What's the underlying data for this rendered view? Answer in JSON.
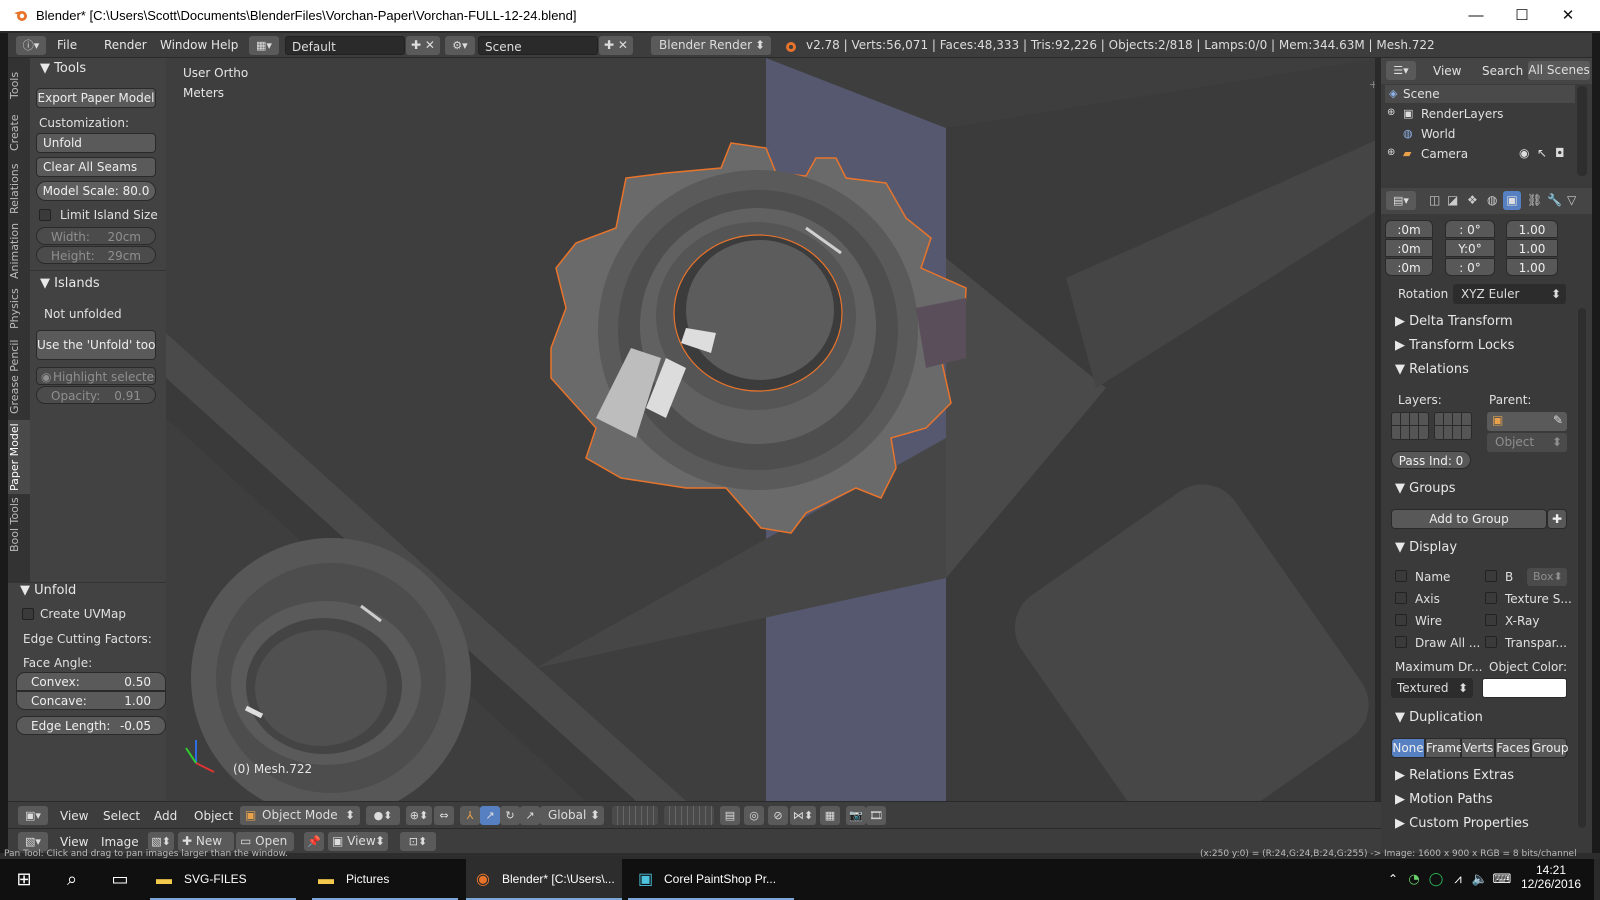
{
  "window": {
    "title": "Blender* [C:\\Users\\Scott\\Documents\\BlenderFiles\\Vorchan-Paper\\Vorchan-FULL-12-24.blend]",
    "minimize": "—",
    "maximize": "☐",
    "close": "✕"
  },
  "menubar": {
    "menus": [
      "File",
      "Render",
      "Window",
      "Help"
    ],
    "layout": "Default",
    "scene": "Scene",
    "engine": "Blender Render",
    "stats": "v2.78 | Verts:56,071 | Faces:48,333 | Tris:92,226 | Objects:2/818 | Lamps:0/0 | Mem:344.63M | Mesh.722"
  },
  "left_tabs": [
    "Tools",
    "Create",
    "Relations",
    "Animation",
    "Physics",
    "Grease Pencil",
    "Paper Model",
    "Bool Tools"
  ],
  "tools_panel": {
    "header": "Tools",
    "export_button": "Export Paper Model",
    "customization_label": "Customization:",
    "unfold_button": "Unfold",
    "clear_seams_button": "Clear All Seams",
    "model_scale": "Model Scale: 80.0",
    "limit_island_size": "Limit Island Size",
    "width_label": "Width:",
    "width_value": "20cm",
    "height_label": "Height:",
    "height_value": "29cm"
  },
  "islands_panel": {
    "header": "Islands",
    "status": "Not unfolded",
    "hint_button": "Use the 'Unfold' tool",
    "highlight": "Highlight selected ...",
    "opacity_label": "Opacity:",
    "opacity_value": "0.91"
  },
  "unfold_panel": {
    "header": "Unfold",
    "create_uvmap": "Create UVMap",
    "edge_cutting": "Edge Cutting Factors:",
    "face_angle": "Face Angle:",
    "convex_label": "Convex:",
    "convex_value": "0.50",
    "concave_label": "Concave:",
    "concave_value": "1.00",
    "edge_length_label": "Edge Length:",
    "edge_length_value": "-0.05"
  },
  "viewport": {
    "view_name": "User Ortho",
    "units": "Meters",
    "object_label": "(0) Mesh.722"
  },
  "outliner": {
    "menus": [
      "View",
      "Search",
      "All Scenes"
    ],
    "items": [
      "Scene",
      "RenderLayers",
      "World",
      "Camera"
    ]
  },
  "properties": {
    "location": [
      ":0m",
      ":0m",
      ":0m"
    ],
    "rotation_vals": [
      ": 0°",
      "Y:0°",
      ": 0°"
    ],
    "scale": [
      "1.00",
      "1.00",
      "1.00"
    ],
    "rotation_label": "Rotation",
    "rotation_mode": "XYZ Euler",
    "sections_closed": [
      "Delta Transform",
      "Transform Locks"
    ],
    "relations_header": "Relations",
    "layers_label": "Layers:",
    "parent_label": "Parent:",
    "parent_type": "Object",
    "pass_index": "Pass Ind: 0",
    "groups_header": "Groups",
    "add_to_group": "Add to Group",
    "display_header": "Display",
    "display_left": [
      "Name",
      "Axis",
      "Wire",
      "Draw All ..."
    ],
    "display_right": [
      "B",
      "Texture S...",
      "X-Ray",
      "Transpar..."
    ],
    "bounds_type": "Box",
    "max_draw_label": "Maximum Dr...",
    "object_color_label": "Object Color:",
    "max_draw_value": "Textured",
    "duplication_header": "Duplication",
    "duplication_options": [
      "None",
      "Frame",
      "Verts",
      "Faces",
      "Group"
    ],
    "sections_bottom": [
      "Relations Extras",
      "Motion Paths",
      "Custom Properties"
    ]
  },
  "bottom3d": {
    "menus": [
      "View",
      "Select",
      "Add",
      "Object"
    ],
    "mode": "Object Mode",
    "orientation": "Global"
  },
  "bottom_image": {
    "menus": [
      "View",
      "Image"
    ],
    "new": "New",
    "open": "Open",
    "view": "View"
  },
  "statusbar": {
    "left": "Pan Tool: Click and drag to pan images larger than the window.",
    "right": "(x:250 y:0) = (R:24,G:24,B:24,G:255) -> Image: 1600 x 900 x RGB = 8 bits/channel"
  },
  "taskbar": {
    "apps": [
      "SVG-FILES",
      "Pictures",
      "Blender* [C:\\Users\\...",
      "Corel PaintShop Pr..."
    ],
    "time": "14:21",
    "date": "12/26/2016"
  },
  "colors": {
    "accent_orange": "#e8742c",
    "blue_select": "#5680c2"
  }
}
